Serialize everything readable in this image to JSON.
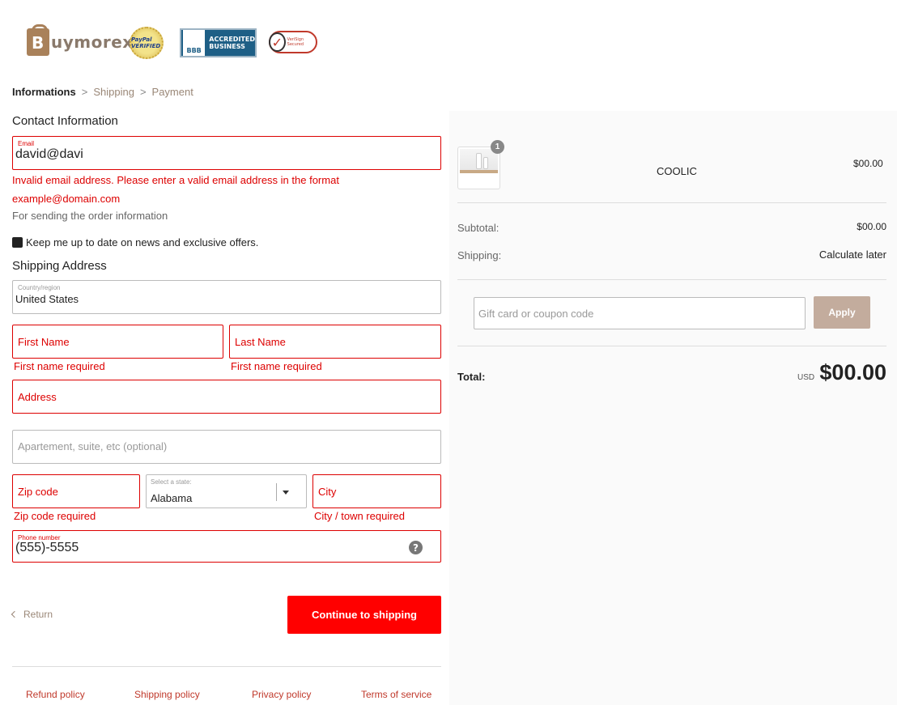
{
  "header": {
    "brand_letter": "B",
    "brand_text": "uymorex",
    "paypal_seal": "PayPal VERIFIED",
    "bbb_mark": "BBB",
    "bbb_line1": "ACCREDITED",
    "bbb_line2": "BUSINESS",
    "verisign_check": "✓",
    "verisign_text": "VeriSign Secured"
  },
  "breadcrumb": {
    "step1": "Informations",
    "sep": ">",
    "step2": "Shipping",
    "step3": "Payment"
  },
  "contact": {
    "title": "Contact Information",
    "email_label": "Email",
    "email_value": "david@davi",
    "email_error_line1": "Invalid email address. Please enter a valid email address in the format",
    "email_error_line2": "example@domain.com",
    "email_hint": "For sending the order information",
    "newsletter_label": "Keep me up to date on news and exclusive offers."
  },
  "shipping": {
    "title": "Shipping Address",
    "country_label": "Country/region",
    "country_value": "United States",
    "first_name_placeholder": "First Name",
    "first_name_error": "First name required",
    "last_name_placeholder": "Last Name",
    "last_name_error": "First name required",
    "address_placeholder": "Address",
    "apartment_placeholder": "Apartement, suite, etc (optional)",
    "zip_placeholder": "Zip code",
    "zip_error": "Zip code required",
    "state_label": "Select a state:",
    "state_value": "Alabama",
    "city_placeholder": "City",
    "city_error": "City / town required",
    "phone_label": "Phone number",
    "phone_value": "(555)-5555",
    "help_icon": "?"
  },
  "actions": {
    "return_label": "Return",
    "continue_label": "Continue to shipping"
  },
  "footer": {
    "links": [
      "Refund policy",
      "Shipping policy",
      "Privacy policy",
      "Terms of service"
    ]
  },
  "summary": {
    "product_qty": "1",
    "product_name": "COOLIC",
    "product_price": "$00.00",
    "subtotal_label": "Subtotal:",
    "subtotal_value": "$00.00",
    "shipping_label": "Shipping:",
    "shipping_value": "Calculate later",
    "coupon_placeholder": "Gift card or coupon code",
    "apply_label": "Apply",
    "total_label": "Total:",
    "currency": "USD",
    "total_value": "$00.00"
  },
  "colors": {
    "error": "#dd0000",
    "primary_button": "#ff0000",
    "apply_button": "#c3ac9d",
    "accent_text": "#9a8777",
    "summary_bg": "#fafafa"
  },
  "icons": [
    "brand-bag-icon",
    "paypal-seal-icon",
    "bbb-logo-icon",
    "verisign-check-icon",
    "caret-down-icon",
    "question-circle-icon",
    "chevron-left-icon"
  ]
}
